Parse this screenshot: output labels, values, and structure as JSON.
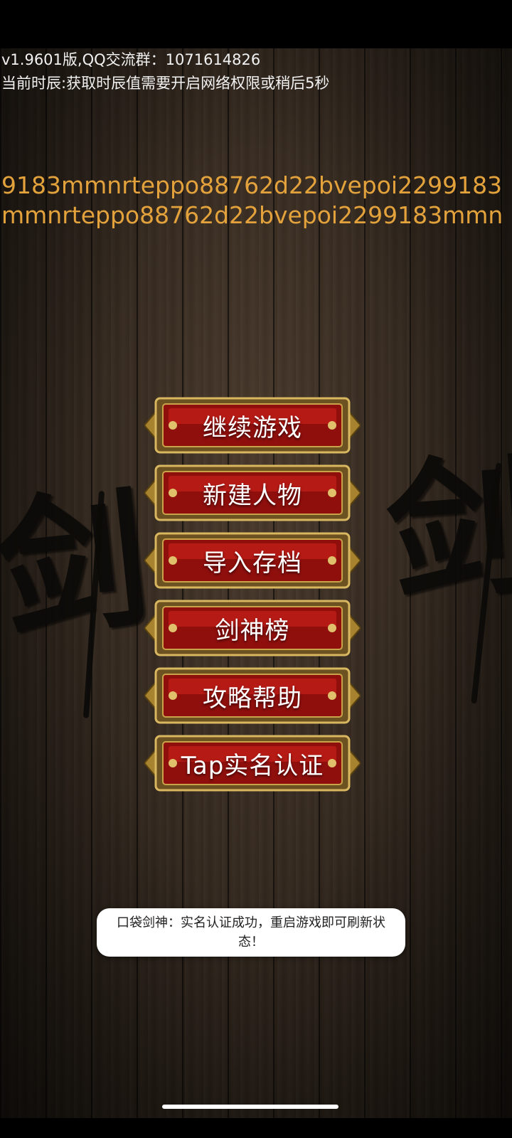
{
  "header": {
    "version_line": "v1.9601版,QQ交流群：1071614826",
    "time_line": "当前时辰:获取时辰值需要开启网络权限或稍后5秒"
  },
  "code_text": "9183mmnrteppo88762d22bvepoi2299183mmnrteppo88762d22bvepoi2299183mmn",
  "decor": {
    "brush_char": "剑",
    "code_color": "#e3a23b"
  },
  "menu": {
    "buttons": [
      {
        "label": "继续游戏"
      },
      {
        "label": "新建人物"
      },
      {
        "label": "导入存档"
      },
      {
        "label": "剑神榜"
      },
      {
        "label": "攻略帮助"
      },
      {
        "label": "Tap实名认证"
      }
    ]
  },
  "toast": {
    "message": "口袋剑神：实名认证成功，重启游戏即可刷新状态！"
  }
}
